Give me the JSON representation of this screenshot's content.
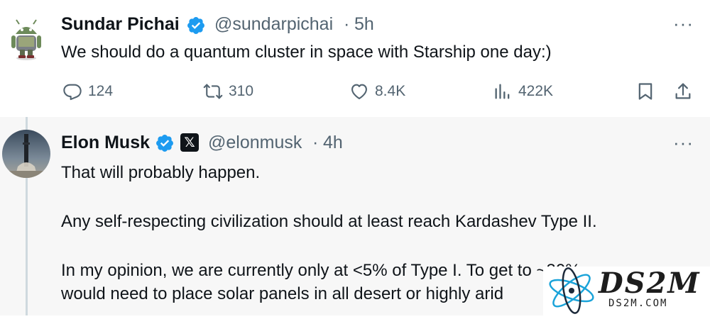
{
  "tweet1": {
    "author_name": "Sundar Pichai",
    "handle": "@sundarpichai",
    "separator": "·",
    "time": "5h",
    "text": "We should do a quantum cluster in space with Starship one day:)",
    "more": "···",
    "replies": "124",
    "reposts": "310",
    "likes": "8.4K",
    "views": "422K"
  },
  "tweet2": {
    "author_name": "Elon Musk",
    "handle": "@elonmusk",
    "separator": "·",
    "time": "4h",
    "x_badge": "𝕏",
    "more": "···",
    "lines": [
      "That will probably happen.",
      "Any self-respecting civilization should at least reach Kardashev Type II.",
      "In my opinion, we are currently only at <5% of Type I. To get to ~30%, we",
      "would need to place solar panels in all desert or highly arid"
    ]
  },
  "watermark": {
    "logo": "DS2M",
    "site": "DS2M.COM"
  },
  "colors": {
    "verified_blue": "#1d9bf0",
    "text_primary": "#0f1419",
    "text_secondary": "#536471",
    "reply_background": "#f7f7f7"
  }
}
